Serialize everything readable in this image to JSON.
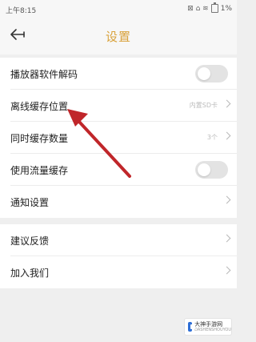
{
  "status_bar": {
    "time": "上午8:15",
    "signal_icons": "⊠ ⌂ ≋",
    "battery_percent": "1%"
  },
  "header": {
    "title": "设置",
    "title_color": "#d9a23b"
  },
  "settings": [
    {
      "label": "播放器软件解码",
      "control": "toggle",
      "on": false
    },
    {
      "label": "离线缓存位置",
      "control": "chevron",
      "value": "内置SD卡"
    },
    {
      "label": "同时缓存数量",
      "control": "chevron",
      "value": "3个"
    },
    {
      "label": "使用流量缓存",
      "control": "toggle",
      "on": false
    },
    {
      "label": "通知设置",
      "control": "chevron"
    }
  ],
  "feedback": {
    "label": "建议反馈"
  },
  "join": {
    "label": "加入我们"
  },
  "annotation": {
    "color": "#c0262a"
  },
  "watermark": {
    "text": "大神手游网",
    "sub": "DASHENSHOUYOU"
  }
}
